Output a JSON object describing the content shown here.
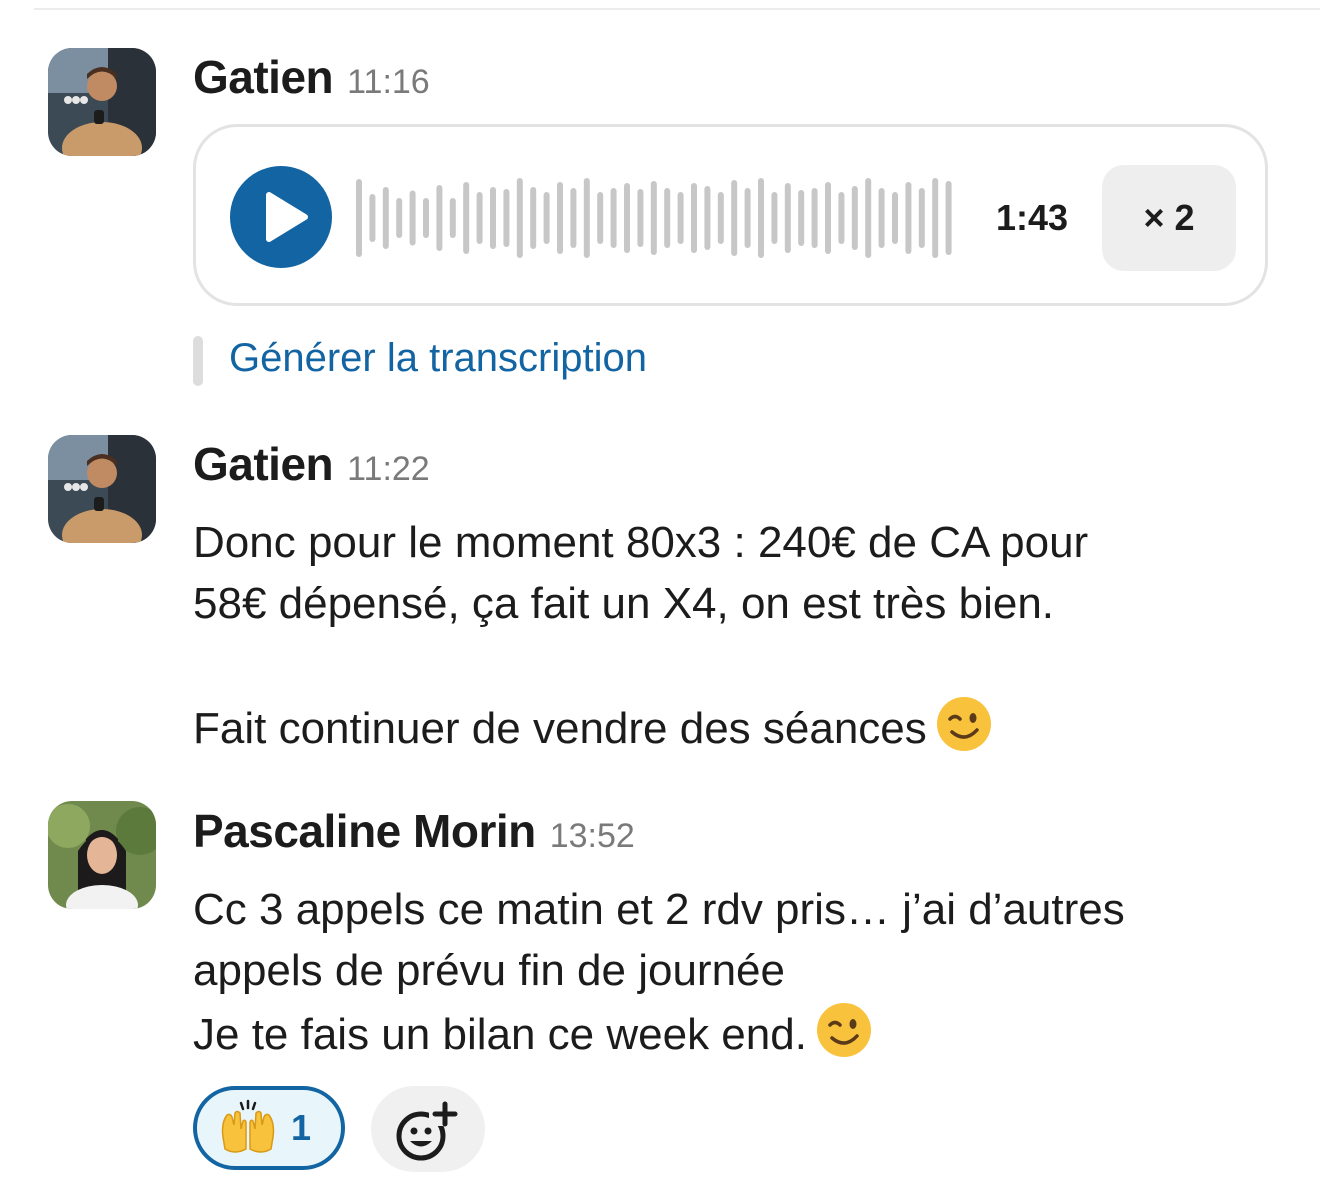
{
  "colors": {
    "accent_blue": "#1264a3",
    "text": "#1d1c1d",
    "muted": "#7a7a7a",
    "waveform": "#c7c7c7"
  },
  "messages": [
    {
      "author": "Gatien",
      "time": "11:16",
      "audio": {
        "duration": "1:43",
        "speed_label": "× 2"
      },
      "transcript_link": "Générer la transcription"
    },
    {
      "author": "Gatien",
      "time": "11:22",
      "lines": [
        "Donc pour le moment 80x3 : 240€ de CA pour",
        "58€ dépensé, ça fait un X4, on est très bien.",
        "",
        "Fait continuer de vendre des séances"
      ],
      "trailing_emoji": "winking-face-icon"
    },
    {
      "author": "Pascaline Morin",
      "time": "13:52",
      "lines": [
        "Cc 3 appels ce matin et 2 rdv pris… j’ai d’autres",
        "appels de prévu fin de journée",
        "Je te fais un bilan ce week end."
      ],
      "trailing_emoji": "winking-face-icon",
      "reactions": [
        {
          "emoji": "raising-hands-icon",
          "count": "1"
        }
      ],
      "add_reaction_icon": "add-reaction-icon"
    }
  ]
}
